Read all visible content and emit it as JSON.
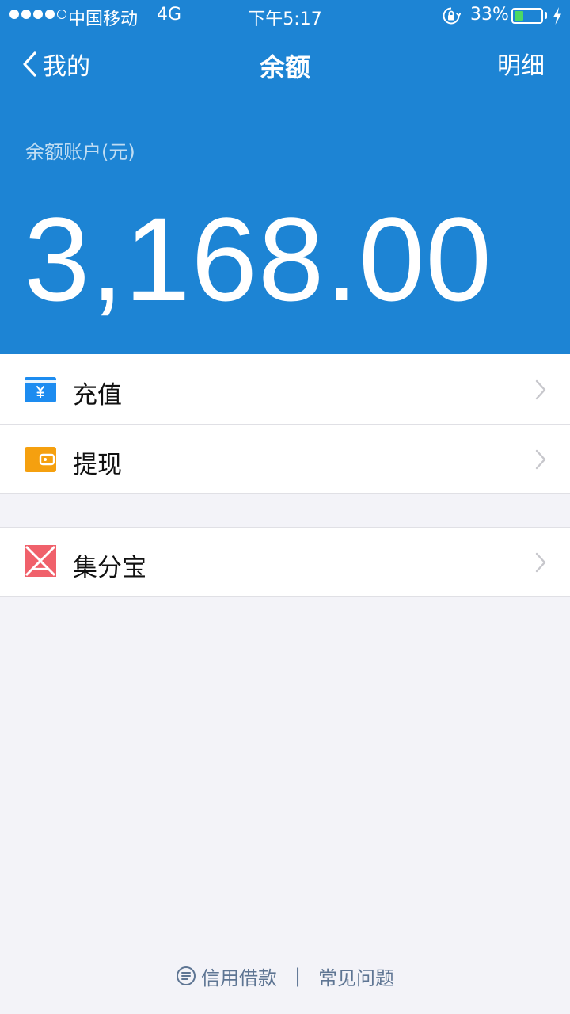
{
  "status_bar": {
    "signal_bars": [
      true,
      true,
      true,
      true,
      false
    ],
    "carrier": "中国移动",
    "network": "4G",
    "time": "下午5:17",
    "battery_percent": "33%",
    "battery_level": 0.33,
    "battery_color": "#4cd964"
  },
  "nav": {
    "back_label": "我的",
    "title": "余额",
    "detail_label": "明细"
  },
  "balance": {
    "label": "余额账户(元)",
    "amount": "3,168.00"
  },
  "menu": {
    "group1": [
      {
        "label": "充值",
        "icon": "yuan-card-icon",
        "icon_color": "#1d8cf0"
      },
      {
        "label": "提现",
        "icon": "wallet-icon",
        "icon_color": "#f5a00f"
      }
    ],
    "group2": [
      {
        "label": "集分宝",
        "icon": "jifenbao-icon",
        "icon_color": "#f0616b"
      }
    ]
  },
  "footer": {
    "credit_loan": "信用借款",
    "separator": "|",
    "faq": "常见问题"
  },
  "colors": {
    "header_blue": "#1d84d4",
    "page_bg": "#f3f3f8",
    "footer_text": "#5e7593"
  }
}
